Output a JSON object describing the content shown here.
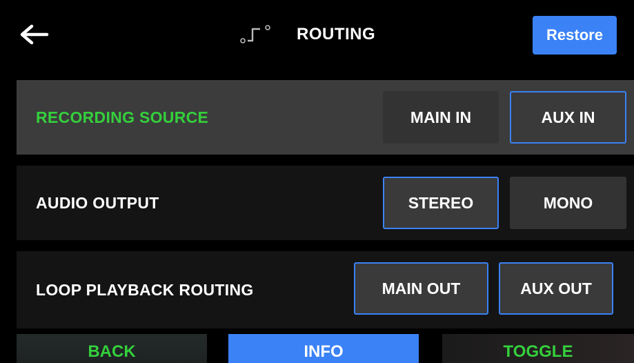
{
  "header": {
    "title": "ROUTING",
    "icon": "routing-icon",
    "back_icon": "left-arrow-icon",
    "restore_label": "Restore"
  },
  "rows": [
    {
      "label": "RECORDING SOURCE",
      "selected": true,
      "options": [
        {
          "label": "MAIN IN",
          "active": false
        },
        {
          "label": "AUX IN",
          "active": true
        }
      ]
    },
    {
      "label": "AUDIO OUTPUT",
      "selected": false,
      "options": [
        {
          "label": "STEREO",
          "active": true
        },
        {
          "label": "MONO",
          "active": false
        }
      ]
    },
    {
      "label": "LOOP PLAYBACK ROUTING",
      "selected": false,
      "options": [
        {
          "label": "MAIN OUT",
          "active": true
        },
        {
          "label": "AUX OUT",
          "active": true
        }
      ]
    }
  ],
  "footer": {
    "back_label": "BACK",
    "info_label": "INFO",
    "toggle_label": "TOGGLE"
  },
  "colors": {
    "accent_blue": "#3b82f6",
    "label_green": "#34d03c",
    "selected_row": "#3c3c3c",
    "row_bg": "#141414"
  }
}
